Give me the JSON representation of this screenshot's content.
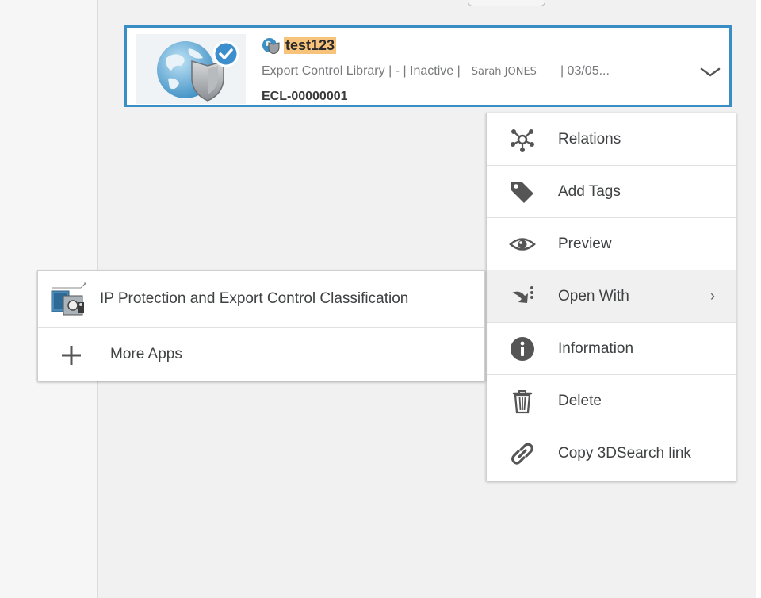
{
  "result": {
    "title": "test123",
    "meta_prefix": "Export Control Library | - | Inactive |",
    "owner": "Sarah JONES",
    "date": "| 03/05...",
    "identifier": "ECL-00000001"
  },
  "menu": {
    "items": [
      {
        "label": "Relations",
        "icon": "relations-icon"
      },
      {
        "label": "Add Tags",
        "icon": "tag-icon"
      },
      {
        "label": "Preview",
        "icon": "eye-icon"
      },
      {
        "label": "Open With",
        "icon": "open-with-icon",
        "submenu_arrow": "›"
      },
      {
        "label": "Information",
        "icon": "info-icon"
      },
      {
        "label": "Delete",
        "icon": "trash-icon"
      },
      {
        "label": "Copy 3DSearch link",
        "icon": "link-icon"
      }
    ]
  },
  "submenu": {
    "items": [
      {
        "label": "IP Protection and Export Control Classification",
        "icon": "ip-protection-app-icon"
      },
      {
        "label": "More Apps",
        "icon": "plus-icon"
      }
    ]
  },
  "colors": {
    "selection_border": "#3a8ec6",
    "highlight": "#f7c37a",
    "menu_hover": "#f0f0f0"
  }
}
